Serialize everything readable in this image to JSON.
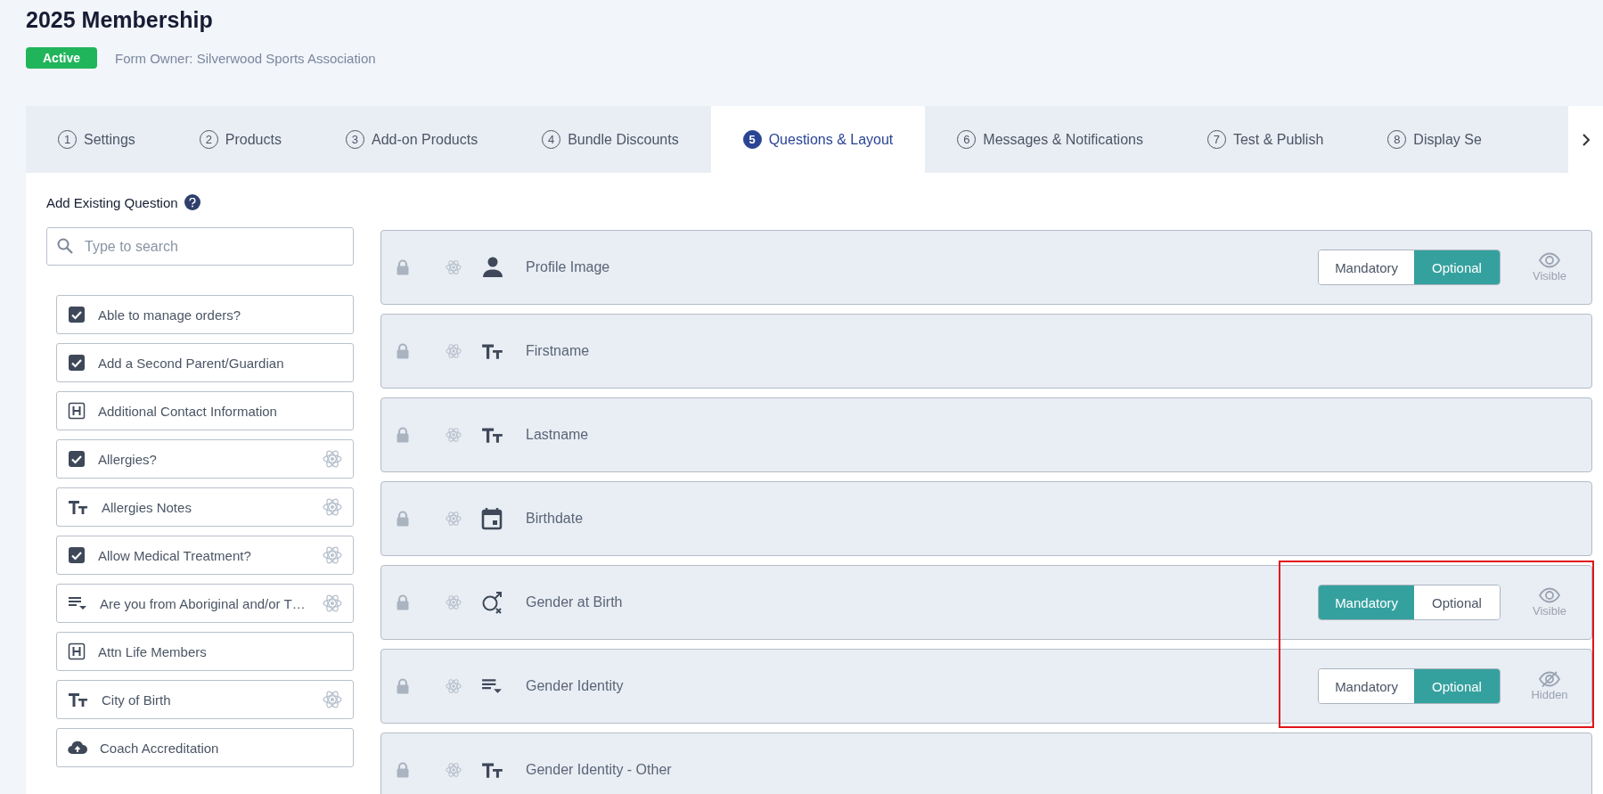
{
  "title": "2025 Membership",
  "status": "Active",
  "owner": "Form Owner: Silverwood Sports Association",
  "tabs": [
    {
      "number": "1",
      "label": "Settings",
      "selected": false
    },
    {
      "number": "2",
      "label": "Products",
      "selected": false
    },
    {
      "number": "3",
      "label": "Add-on Products",
      "selected": false
    },
    {
      "number": "4",
      "label": "Bundle Discounts",
      "selected": false
    },
    {
      "number": "5",
      "label": "Questions & Layout",
      "selected": true
    },
    {
      "number": "6",
      "label": "Messages & Notifications",
      "selected": false
    },
    {
      "number": "7",
      "label": "Test & Publish",
      "selected": false
    },
    {
      "number": "8",
      "label": "Display Se",
      "selected": false
    }
  ],
  "add_panel": {
    "heading": "Add Existing Question",
    "search": {
      "placeholder": "Type to search"
    },
    "questions": [
      {
        "kind": "checkbox",
        "label": "Able to manage orders?",
        "linked": false
      },
      {
        "kind": "checkbox",
        "label": "Add a Second Parent/Guardian",
        "linked": false
      },
      {
        "kind": "heading",
        "label": "Additional Contact Information",
        "linked": false
      },
      {
        "kind": "checkbox",
        "label": "Allergies?",
        "linked": true
      },
      {
        "kind": "text",
        "label": "Allergies Notes",
        "linked": true
      },
      {
        "kind": "checkbox",
        "label": "Allow Medical Treatment?",
        "linked": true
      },
      {
        "kind": "dropdown",
        "label": "Are you from Aboriginal and/or T…",
        "linked": true
      },
      {
        "kind": "heading",
        "label": "Attn Life Members",
        "linked": false
      },
      {
        "kind": "text",
        "label": "City of Birth",
        "linked": true
      },
      {
        "kind": "upload",
        "label": "Coach Accreditation",
        "linked": false
      }
    ]
  },
  "form_questions": [
    {
      "kind": "person",
      "label": "Profile Image",
      "requirement": [
        {
          "label": "Mandatory",
          "selected": false
        },
        {
          "label": "Optional",
          "selected": true
        }
      ],
      "visibility": {
        "label": "Visible",
        "hidden": false
      },
      "highlighted": false
    },
    {
      "kind": "text",
      "label": "Firstname",
      "highlighted": false
    },
    {
      "kind": "text",
      "label": "Lastname",
      "highlighted": false
    },
    {
      "kind": "calendar",
      "label": "Birthdate",
      "highlighted": false
    },
    {
      "kind": "gender",
      "label": "Gender at Birth",
      "requirement": [
        {
          "label": "Mandatory",
          "selected": true
        },
        {
          "label": "Optional",
          "selected": false
        }
      ],
      "visibility": {
        "label": "Visible",
        "hidden": false
      },
      "highlighted": true
    },
    {
      "kind": "dropdown",
      "label": "Gender Identity",
      "requirement": [
        {
          "label": "Mandatory",
          "selected": false
        },
        {
          "label": "Optional",
          "selected": true
        }
      ],
      "visibility": {
        "label": "Hidden",
        "hidden": true
      },
      "highlighted": true
    },
    {
      "kind": "text",
      "label": "Gender Identity - Other",
      "highlighted": false
    }
  ]
}
